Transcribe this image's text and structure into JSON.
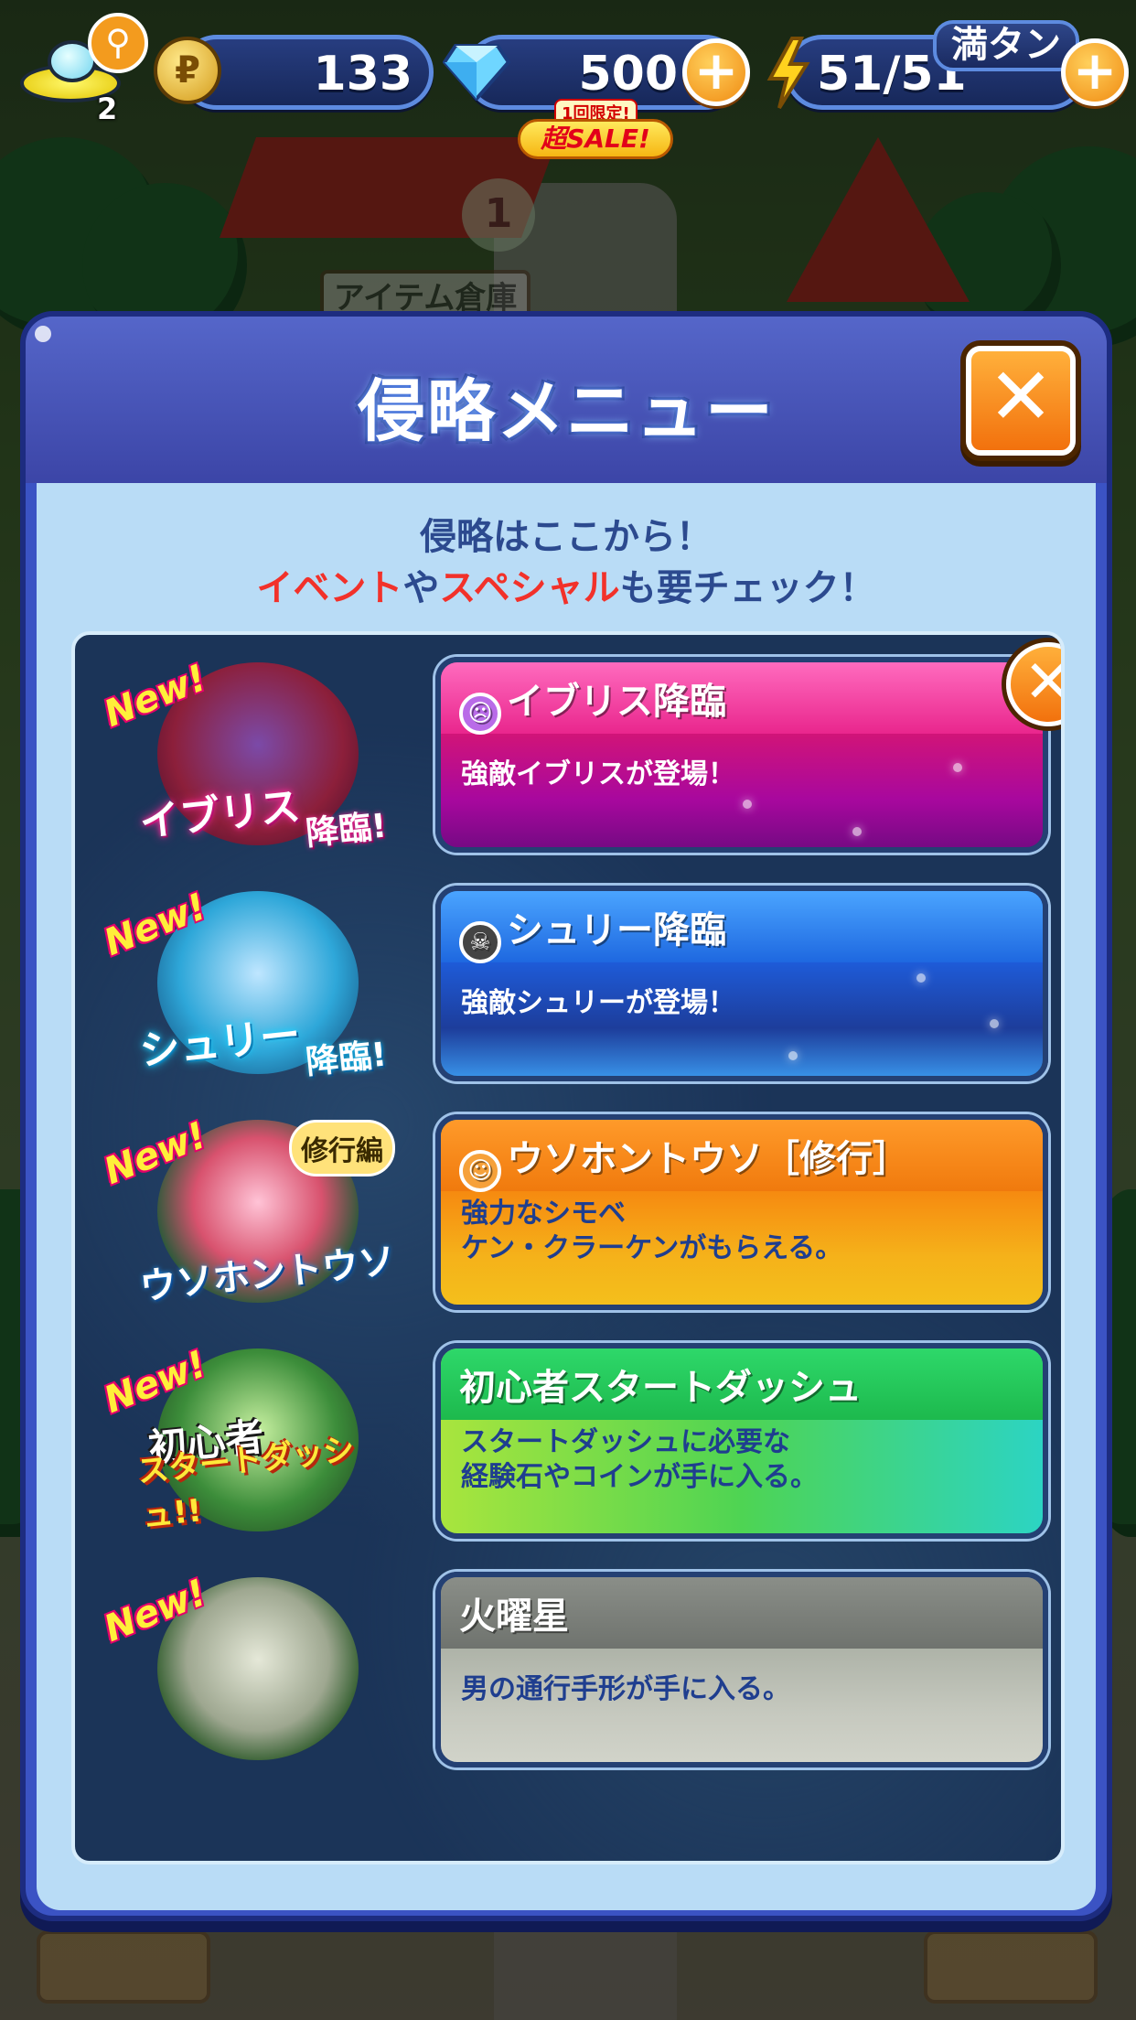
{
  "status_bar": {
    "ufo_count": "2",
    "coins": "133",
    "gems": "500",
    "stamina": "51/51",
    "stamina_full_label": "満タン",
    "sale_top": "1回限定!",
    "sale_main": "超SALE!"
  },
  "background": {
    "warehouse_sign": "アイテム倉庫",
    "stage_number": "1"
  },
  "modal": {
    "title": "侵略メニュー",
    "close_label": "✕",
    "subtitle_line1": "侵略はここから！",
    "subtitle_line2_part1": "イベント",
    "subtitle_line2_part2": "や",
    "subtitle_line2_part3": "スペシャル",
    "subtitle_line2_part4": "も要チェック！"
  },
  "menu_items": [
    {
      "new_tag": "New!",
      "thumb_label": "イブリス",
      "thumb_sub": "降臨!",
      "type_icon": "purple-face",
      "title": "イブリス降臨",
      "desc_line1": "強敵イブリスが登場！",
      "desc_line2": "",
      "color": "#e3208b"
    },
    {
      "new_tag": "New!",
      "thumb_label": "シュリー",
      "thumb_sub": "降臨!",
      "type_icon": "dark-face",
      "title": "シュリー降臨",
      "desc_line1": "強敵シュリーが登場！",
      "desc_line2": "",
      "color": "#1e68e0"
    },
    {
      "new_tag": "New!",
      "thumb_label": "ウソホントウソ",
      "thumb_sub": "修行編",
      "type_icon": "orange-face",
      "title": "ウソホントウソ［修行］",
      "desc_line1": "強力なシモベ",
      "desc_line2": "ケン・クラーケンがもらえる。",
      "color": "#f68a10"
    },
    {
      "new_tag": "New!",
      "thumb_label": "初心者",
      "thumb_sub": "スタートダッシュ!!",
      "type_icon": "",
      "title": "初心者スタートダッシュ",
      "desc_line1": "スタートダッシュに必要な",
      "desc_line2": "経験石やコインが手に入る。",
      "color": "#2ed86a"
    },
    {
      "new_tag": "New!",
      "thumb_label": "",
      "thumb_sub": "",
      "type_icon": "",
      "title": "火曜星",
      "desc_line1": "男の通行手形が手に入る。",
      "desc_line2": "",
      "color": "#8a8e88"
    }
  ]
}
